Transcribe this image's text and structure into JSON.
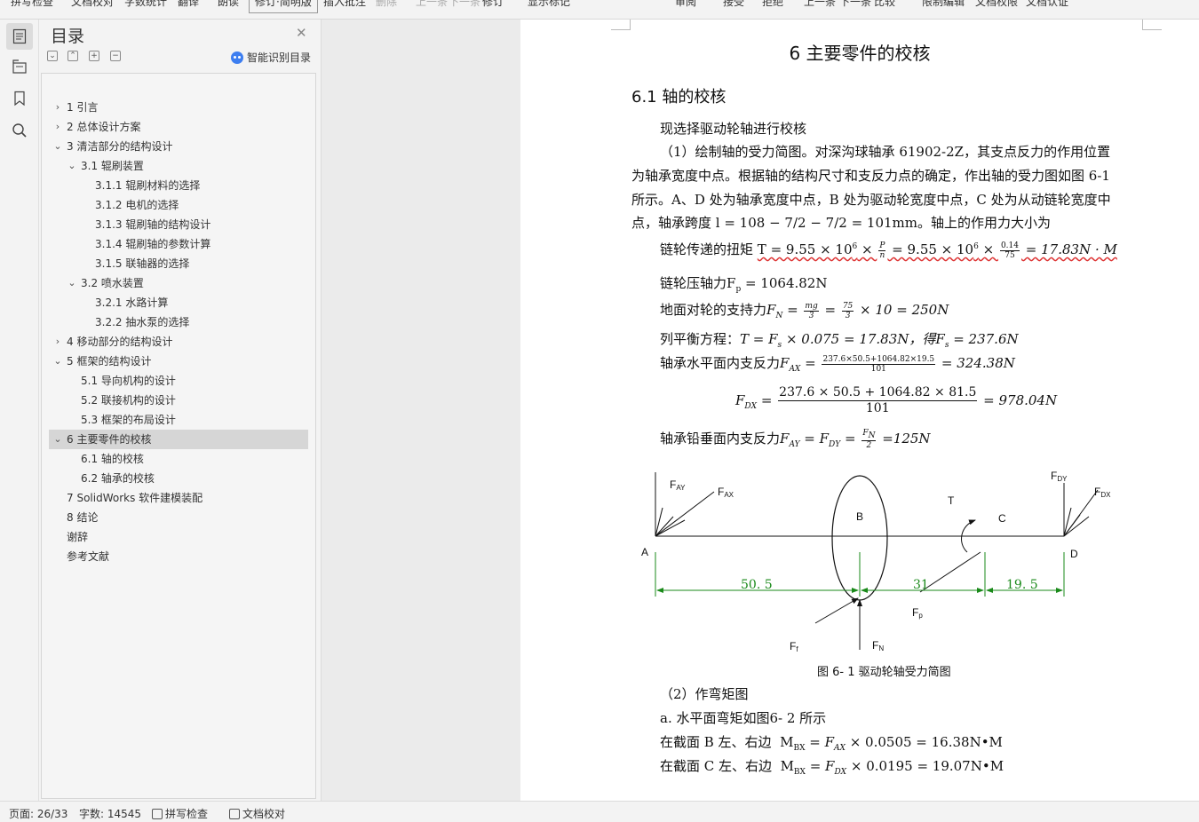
{
  "toolbar": {
    "items": [
      "拼写检查",
      "文档校对",
      "字数统计",
      "翻译",
      "朗读",
      "修订·简明版",
      "插入批注",
      "删除",
      "上一条",
      "下一条",
      "修订",
      "显示标记",
      "审阅",
      "接受",
      "拒绝",
      "上一条",
      "下一条",
      "比较",
      "限制编辑",
      "文档权限",
      "文档认证"
    ]
  },
  "toc": {
    "title": "目录",
    "smart_label": "智能识别目录",
    "controls": [
      "⌄",
      "⌃",
      "+",
      "−"
    ],
    "items": [
      {
        "label": "1 引言",
        "level": 1,
        "expander": "›"
      },
      {
        "label": "2 总体设计方案",
        "level": 1,
        "expander": "›"
      },
      {
        "label": "3 清洁部分的结构设计",
        "level": 1,
        "expander": "⌄"
      },
      {
        "label": "3.1 辊刷装置",
        "level": 2,
        "expander": "⌄"
      },
      {
        "label": "3.1.1 辊刷材料的选择",
        "level": 3,
        "expander": ""
      },
      {
        "label": "3.1.2 电机的选择",
        "level": 3,
        "expander": ""
      },
      {
        "label": "3.1.3 辊刷轴的结构设计",
        "level": 3,
        "expander": ""
      },
      {
        "label": "3.1.4 辊刷轴的参数计算",
        "level": 3,
        "expander": ""
      },
      {
        "label": "3.1.5 联轴器的选择",
        "level": 3,
        "expander": ""
      },
      {
        "label": "3.2 喷水装置",
        "level": 2,
        "expander": "⌄"
      },
      {
        "label": "3.2.1 水路计算",
        "level": 3,
        "expander": ""
      },
      {
        "label": "3.2.2 抽水泵的选择",
        "level": 3,
        "expander": ""
      },
      {
        "label": "4 移动部分的结构设计",
        "level": 1,
        "expander": "›"
      },
      {
        "label": "5 框架的结构设计",
        "level": 1,
        "expander": "⌄"
      },
      {
        "label": "5.1 导向机构的设计",
        "level": 2,
        "expander": ""
      },
      {
        "label": "5.2 联接机构的设计",
        "level": 2,
        "expander": ""
      },
      {
        "label": "5.3 框架的布局设计",
        "level": 2,
        "expander": ""
      },
      {
        "label": "6 主要零件的校核",
        "level": 1,
        "expander": "⌄",
        "selected": true
      },
      {
        "label": "6.1 轴的校核",
        "level": 2,
        "expander": ""
      },
      {
        "label": "6.2 轴承的校核",
        "level": 2,
        "expander": ""
      },
      {
        "label": "7 SolidWorks 软件建模装配",
        "level": 1,
        "expander": ""
      },
      {
        "label": "8 结论",
        "level": 1,
        "expander": ""
      },
      {
        "label": "谢辞",
        "level": 1,
        "expander": ""
      },
      {
        "label": "参考文献",
        "level": 1,
        "expander": ""
      }
    ]
  },
  "doc": {
    "h1": "6 主要零件的校核",
    "h2": "6.1 轴的校核",
    "p1": "现选择驱动轮轴进行校核",
    "p2_lines": [
      "（1）绘制轴的受力简图。对深沟球轴承 61902-2Z，其支点反力的作用位置",
      "为轴承宽度中点。根据轴的结构尺寸和支反力点的确定，作出轴的受力图如图 6-1",
      "所示。A、D 处为轴承宽度中点，B 处为驱动轮宽度中点，C 处为从动链轮宽度中"
    ],
    "p2_last_prefix": "点，轴承跨度 ",
    "p2_last_math": "l = 108 − 7/2 − 7/2 = 101mm",
    "p2_last_suffix": "。轴上的作用力大小为",
    "eq_torque_label": "链轮传递的扭矩",
    "eq_torque_a": "T = 9.55 × 10",
    "eq_torque_exp": "6",
    "eq_torque_b": " × ",
    "eq_torque_f1n": "P",
    "eq_torque_f1d": "n",
    "eq_torque_c": " = 9.55 × 10",
    "eq_torque_d": " × ",
    "eq_torque_f2n": "0.14",
    "eq_torque_f2d": "75",
    "eq_torque_e": " = 17.83N · M",
    "eq_fp_label": "链轮压轴力",
    "eq_fp_math": "F",
    "eq_fp_sub": "p",
    "eq_fp_val": " = 1064.82N",
    "eq_fn_label": "地面对轮的支持力",
    "eq_fn_a": "F",
    "eq_fn_sub": "N",
    "eq_fn_b": " = ",
    "eq_fn_f1n": "mg",
    "eq_fn_f1d": "3",
    "eq_fn_c": " = ",
    "eq_fn_f2n": "75",
    "eq_fn_f2d": "3",
    "eq_fn_d": " × 10 = 250N",
    "eq_bal_label": "列平衡方程：",
    "eq_bal_a": "T = F",
    "eq_bal_sub": "s",
    "eq_bal_b": " × 0.075 = 17.83N，得",
    "eq_bal_c": "F",
    "eq_bal_sub2": "s",
    "eq_bal_d": " = 237.6N",
    "eq_fax_label": "轴承水平面内支反力",
    "eq_fax_a": "F",
    "eq_fax_sub": "AX",
    "eq_fax_b": " = ",
    "eq_fax_fn": "237.6×50.5+1064.82×19.5",
    "eq_fax_fd": "101",
    "eq_fax_c": " = 324.38N",
    "eq_fdx_a": "F",
    "eq_fdx_sub": "DX",
    "eq_fdx_b": " = ",
    "eq_fdx_fn": "237.6 × 50.5 + 1064.82 × 81.5",
    "eq_fdx_fd": "101",
    "eq_fdx_c": " = 978.04N",
    "eq_fay_label": "轴承铅垂面内支反力",
    "eq_fay_a": "F",
    "eq_fay_sub": "AY",
    "eq_fay_b": " = F",
    "eq_fay_sub2": "DY",
    "eq_fay_c": " = ",
    "eq_fay_fn": "F",
    "eq_fay_fnsub": "N",
    "eq_fay_fd": "2",
    "eq_fay_d": " =125N",
    "figure": {
      "labels": {
        "FAY": "F",
        "FAYs": "AY",
        "FAX": "F",
        "FAXs": "AX",
        "B": "B",
        "T": "T",
        "C": "C",
        "FDY": "F",
        "FDYs": "DY",
        "FDX": "F",
        "FDXs": "DX",
        "A": "A",
        "D": "D",
        "Fp": "F",
        "Fps": "p",
        "Ff": "F",
        "Ffs": "f",
        "FN": "F",
        "FNs": "N"
      },
      "dims": [
        "50. 5",
        "31",
        "19. 5"
      ],
      "caption": "图 6- 1   驱动轮轴受力简图",
      "dim_color": "#1a8a1a"
    },
    "p3": "（2）作弯矩图",
    "p4": "a. 水平面弯矩如图6- 2 所示",
    "p5_label": "在截面 B 左、右边",
    "p5_a": "M",
    "p5_sub": "BX",
    "p5_b": " = F",
    "p5_sub2": "AX",
    "p5_c": " × 0.0505 = 16.38N•M",
    "p6_label": "在截面 C 左、右边",
    "p6_a": "M",
    "p6_sub": "BX",
    "p6_b": " = F",
    "p6_sub2": "DX",
    "p6_c": " × 0.0195 = 19.07N•M"
  },
  "status": {
    "page": "页面: 26/33",
    "words": "字数: 14545",
    "spell": "拼写检查",
    "proof": "文档校对"
  }
}
